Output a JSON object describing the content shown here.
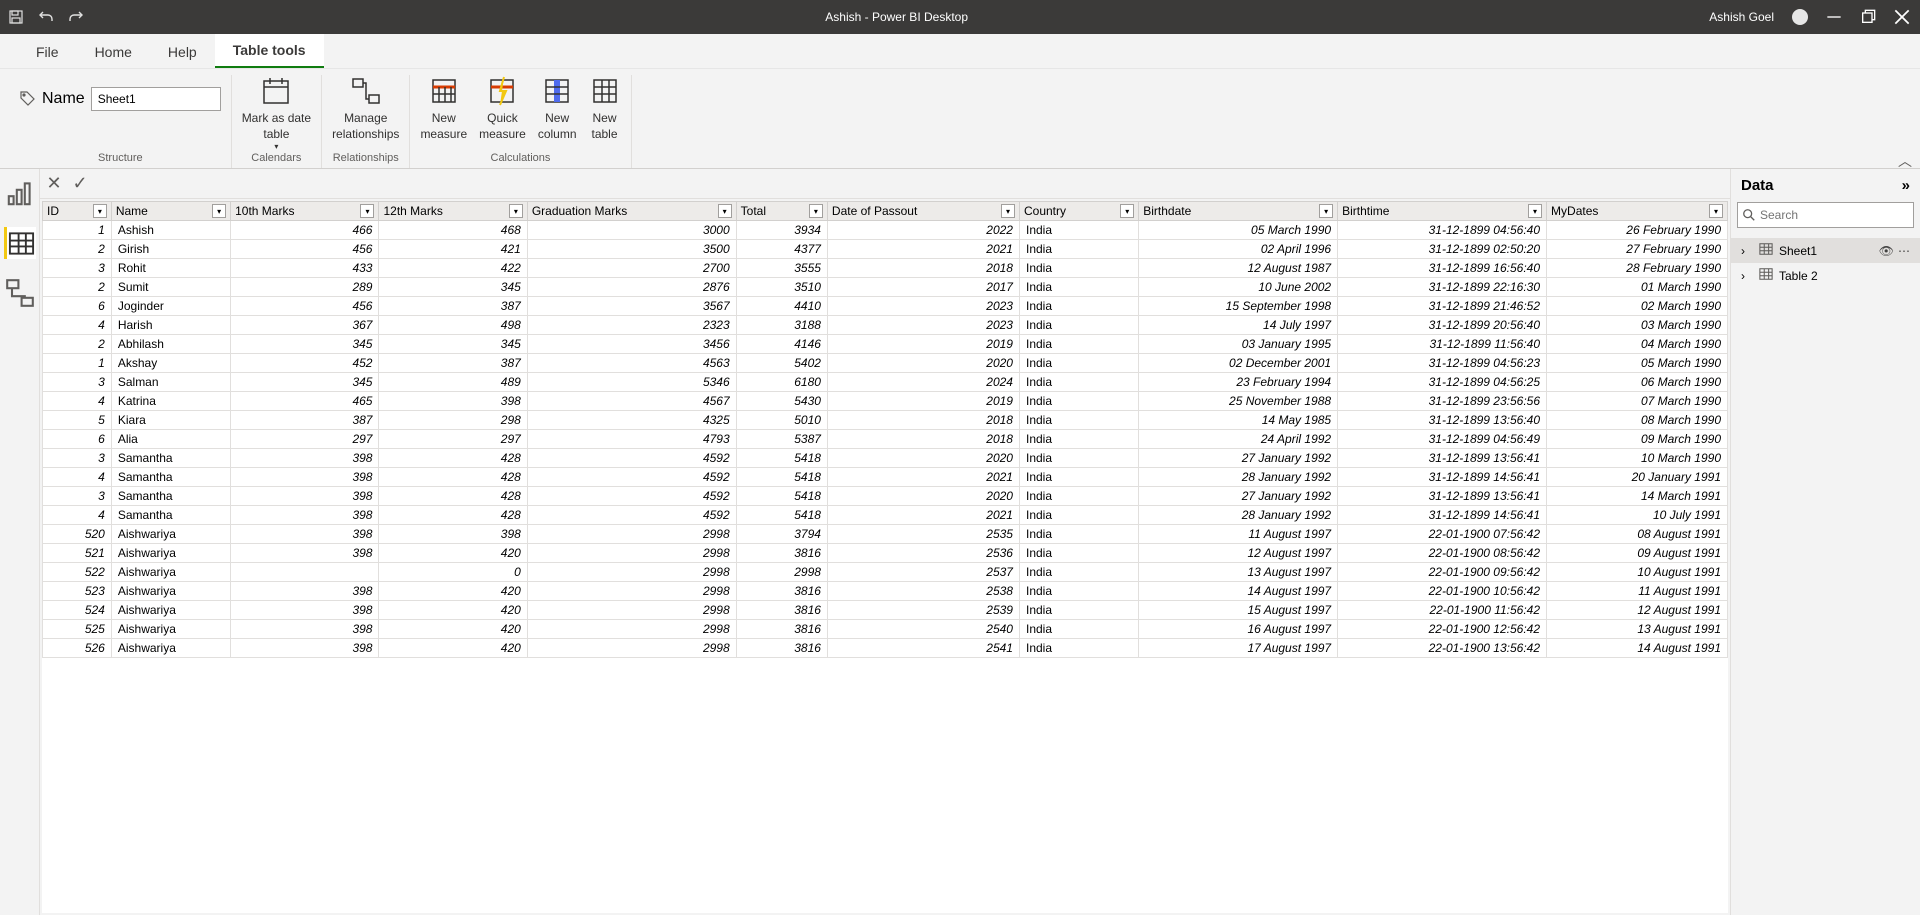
{
  "titlebar": {
    "appTitle": "Ashish - Power BI Desktop",
    "userName": "Ashish Goel"
  },
  "ribbonTabs": {
    "file": "File",
    "home": "Home",
    "help": "Help",
    "tableTools": "Table tools"
  },
  "ribbon": {
    "nameLabel": "Name",
    "nameValue": "Sheet1",
    "structureGroup": "Structure",
    "markAsDate": "Mark as date\ntable",
    "calendarsGroup": "Calendars",
    "manageRel": "Manage\nrelationships",
    "relationshipsGroup": "Relationships",
    "newMeasure": "New\nmeasure",
    "quickMeasure": "Quick\nmeasure",
    "newColumn": "New\ncolumn",
    "newTable": "New\ntable",
    "calculationsGroup": "Calculations"
  },
  "dataPane": {
    "title": "Data",
    "searchPlaceholder": "Search",
    "items": [
      {
        "label": "Sheet1",
        "selected": true,
        "icon": "table"
      },
      {
        "label": "Table 2",
        "selected": false,
        "icon": "table2"
      }
    ]
  },
  "grid": {
    "columns": [
      "ID",
      "Name",
      "10th Marks",
      "12th Marks",
      "Graduation Marks",
      "Total",
      "Date of Passout",
      "Country",
      "Birthdate",
      "Birthtime",
      "MyDates"
    ],
    "colAlign": [
      "num",
      "txt",
      "num",
      "num",
      "num",
      "num",
      "num",
      "txt",
      "dt",
      "dt",
      "dt"
    ],
    "rows": [
      [
        "1",
        "Ashish",
        "466",
        "468",
        "3000",
        "3934",
        "2022",
        "India",
        "05 March 1990",
        "31-12-1899 04:56:40",
        "26 February 1990"
      ],
      [
        "2",
        "Girish",
        "456",
        "421",
        "3500",
        "4377",
        "2021",
        "India",
        "02 April 1996",
        "31-12-1899 02:50:20",
        "27 February 1990"
      ],
      [
        "3",
        "Rohit",
        "433",
        "422",
        "2700",
        "3555",
        "2018",
        "India",
        "12 August 1987",
        "31-12-1899 16:56:40",
        "28 February 1990"
      ],
      [
        "2",
        "Sumit",
        "289",
        "345",
        "2876",
        "3510",
        "2017",
        "India",
        "10 June 2002",
        "31-12-1899 22:16:30",
        "01 March 1990"
      ],
      [
        "6",
        "Joginder",
        "456",
        "387",
        "3567",
        "4410",
        "2023",
        "India",
        "15 September 1998",
        "31-12-1899 21:46:52",
        "02 March 1990"
      ],
      [
        "4",
        "Harish",
        "367",
        "498",
        "2323",
        "3188",
        "2023",
        "India",
        "14 July 1997",
        "31-12-1899 20:56:40",
        "03 March 1990"
      ],
      [
        "2",
        "Abhilash",
        "345",
        "345",
        "3456",
        "4146",
        "2019",
        "India",
        "03 January 1995",
        "31-12-1899 11:56:40",
        "04 March 1990"
      ],
      [
        "1",
        "Akshay",
        "452",
        "387",
        "4563",
        "5402",
        "2020",
        "India",
        "02 December 2001",
        "31-12-1899 04:56:23",
        "05 March 1990"
      ],
      [
        "3",
        "Salman",
        "345",
        "489",
        "5346",
        "6180",
        "2024",
        "India",
        "23 February 1994",
        "31-12-1899 04:56:25",
        "06 March 1990"
      ],
      [
        "4",
        "Katrina",
        "465",
        "398",
        "4567",
        "5430",
        "2019",
        "India",
        "25 November 1988",
        "31-12-1899 23:56:56",
        "07 March 1990"
      ],
      [
        "5",
        "Kiara",
        "387",
        "298",
        "4325",
        "5010",
        "2018",
        "India",
        "14 May 1985",
        "31-12-1899 13:56:40",
        "08 March 1990"
      ],
      [
        "6",
        "Alia",
        "297",
        "297",
        "4793",
        "5387",
        "2018",
        "India",
        "24 April 1992",
        "31-12-1899 04:56:49",
        "09 March 1990"
      ],
      [
        "3",
        "Samantha",
        "398",
        "428",
        "4592",
        "5418",
        "2020",
        "India",
        "27 January 1992",
        "31-12-1899 13:56:41",
        "10 March 1990"
      ],
      [
        "4",
        "Samantha",
        "398",
        "428",
        "4592",
        "5418",
        "2021",
        "India",
        "28 January 1992",
        "31-12-1899 14:56:41",
        "20 January 1991"
      ],
      [
        "3",
        "Samantha",
        "398",
        "428",
        "4592",
        "5418",
        "2020",
        "India",
        "27 January 1992",
        "31-12-1899 13:56:41",
        "14 March 1991"
      ],
      [
        "4",
        "Samantha",
        "398",
        "428",
        "4592",
        "5418",
        "2021",
        "India",
        "28 January 1992",
        "31-12-1899 14:56:41",
        "10 July 1991"
      ],
      [
        "520",
        "Aishwariya",
        "398",
        "398",
        "2998",
        "3794",
        "2535",
        "India",
        "11 August 1997",
        "22-01-1900 07:56:42",
        "08 August 1991"
      ],
      [
        "521",
        "Aishwariya",
        "398",
        "420",
        "2998",
        "3816",
        "2536",
        "India",
        "12 August 1997",
        "22-01-1900 08:56:42",
        "09 August 1991"
      ],
      [
        "522",
        "Aishwariya",
        "",
        "0",
        "2998",
        "2998",
        "2537",
        "India",
        "13 August 1997",
        "22-01-1900 09:56:42",
        "10 August 1991"
      ],
      [
        "523",
        "Aishwariya",
        "398",
        "420",
        "2998",
        "3816",
        "2538",
        "India",
        "14 August 1997",
        "22-01-1900 10:56:42",
        "11 August 1991"
      ],
      [
        "524",
        "Aishwariya",
        "398",
        "420",
        "2998",
        "3816",
        "2539",
        "India",
        "15 August 1997",
        "22-01-1900 11:56:42",
        "12 August 1991"
      ],
      [
        "525",
        "Aishwariya",
        "398",
        "420",
        "2998",
        "3816",
        "2540",
        "India",
        "16 August 1997",
        "22-01-1900 12:56:42",
        "13 August 1991"
      ],
      [
        "526",
        "Aishwariya",
        "398",
        "420",
        "2998",
        "3816",
        "2541",
        "India",
        "17 August 1997",
        "22-01-1900 13:56:42",
        "14 August 1991"
      ]
    ]
  }
}
